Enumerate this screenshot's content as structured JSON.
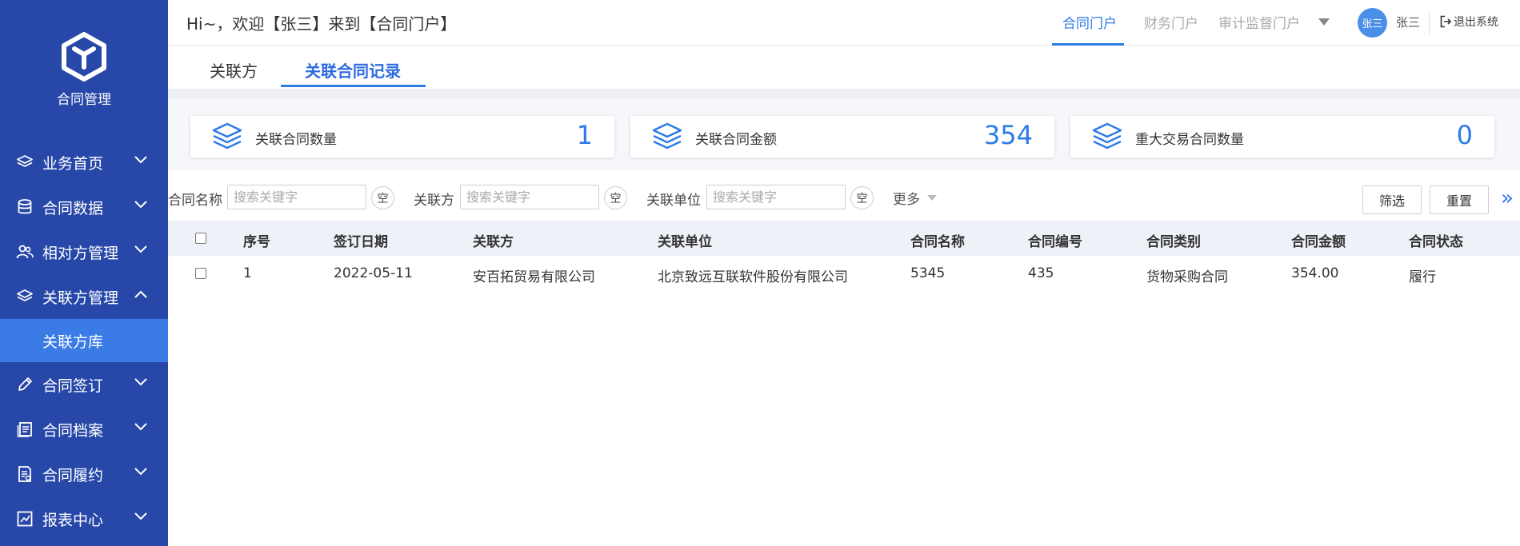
{
  "sidebar": {
    "logo_text": "合同管理",
    "items": [
      {
        "label": "业务首页",
        "icon": "layers-icon",
        "expanded": false
      },
      {
        "label": "合同数据",
        "icon": "database-icon",
        "expanded": false
      },
      {
        "label": "相对方管理",
        "icon": "users-icon",
        "expanded": false
      },
      {
        "label": "关联方管理",
        "icon": "layers-icon",
        "expanded": true
      },
      {
        "label": "合同签订",
        "icon": "pen-icon",
        "expanded": false
      },
      {
        "label": "合同档案",
        "icon": "archive-icon",
        "expanded": false
      },
      {
        "label": "合同履约",
        "icon": "document-icon",
        "expanded": false
      },
      {
        "label": "报表中心",
        "icon": "chart-icon",
        "expanded": false
      }
    ],
    "active_subitem": "关联方库"
  },
  "header": {
    "greeting": "Hi~，欢迎【张三】来到【合同门户】",
    "portals": [
      "合同门户",
      "财务门户",
      "审计监督门户"
    ],
    "active_portal": "合同门户",
    "avatar_text": "张三",
    "username": "张三",
    "logout": "退出系统"
  },
  "subtabs": [
    "关联方",
    "关联合同记录"
  ],
  "active_subtab": "关联合同记录",
  "stats": [
    {
      "label": "关联合同数量",
      "value": "1"
    },
    {
      "label": "关联合同金额",
      "value": "354"
    },
    {
      "label": "重大交易合同数量",
      "value": "0"
    }
  ],
  "filters": {
    "fields": [
      {
        "label": "合同名称",
        "placeholder": "搜索关键字"
      },
      {
        "label": "关联方",
        "placeholder": "搜索关键字"
      },
      {
        "label": "关联单位",
        "placeholder": "搜索关键字"
      }
    ],
    "clear_label": "空",
    "more_label": "更多",
    "filter_button": "筛选",
    "reset_button": "重置",
    "expand_icon": "»"
  },
  "table": {
    "headers": [
      "序号",
      "签订日期",
      "关联方",
      "关联单位",
      "合同名称",
      "合同编号",
      "合同类别",
      "合同金额",
      "合同状态"
    ],
    "rows": [
      [
        "1",
        "2022-05-11",
        "安百拓贸易有限公司",
        "北京致远互联软件股份有限公司",
        "5345",
        "435",
        "货物采购合同",
        "354.00",
        "履行"
      ]
    ]
  },
  "colors": {
    "sidebar_bg": "#2748a8",
    "sidebar_active": "#3a7be6",
    "accent": "#2d7be6"
  }
}
